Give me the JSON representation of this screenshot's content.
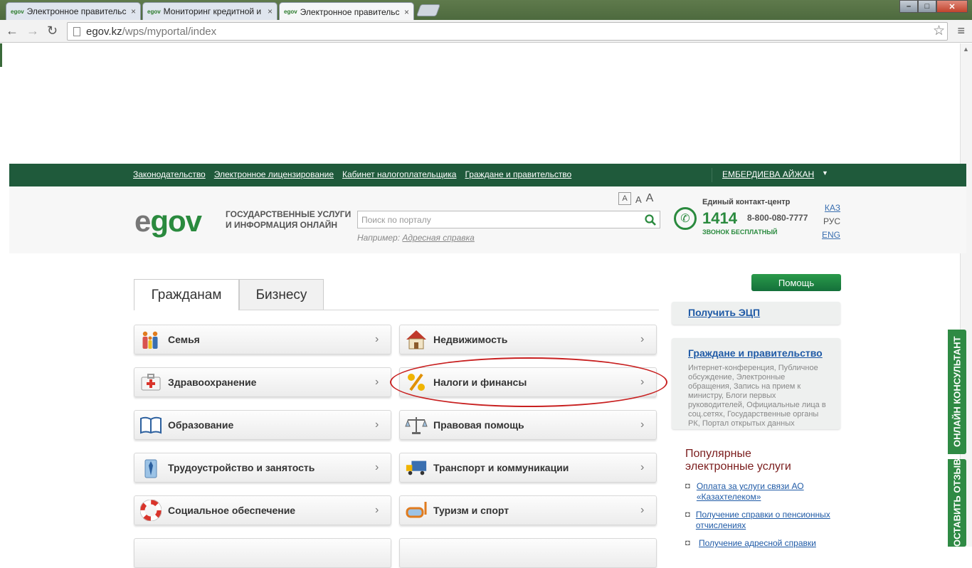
{
  "browser": {
    "tabs": [
      {
        "title": "Электронное правительс",
        "favicon": "egov"
      },
      {
        "title": "Мониторинг кредитной и",
        "favicon": "egov"
      },
      {
        "title": "Электронное правительс",
        "favicon": "egov"
      }
    ],
    "url_host": "egov.kz",
    "url_path": "/wps/myportal/index"
  },
  "topnav": {
    "links": [
      "Законодательство",
      "Электронное лицензирование",
      "Кабинет налогоплательщика",
      "Граждане и правительство"
    ],
    "user": "ЕМБЕРДИЕВА АЙЖАН"
  },
  "header": {
    "logo_e": "e",
    "logo_gov": "gov",
    "tagline1": "ГОСУДАРСТВЕННЫЕ УСЛУГИ",
    "tagline2": "И ИНФОРМАЦИЯ ОНЛАЙН",
    "font_sizes": [
      "A",
      "A",
      "A"
    ],
    "search_placeholder": "Поиск по порталу",
    "example_prefix": "Например:",
    "example_link": "Адресная справка",
    "contact_title": "Единый контакт-центр",
    "contact_number": "1414",
    "contact_alt": "8-800-080-7777",
    "contact_free": "ЗВОНОК БЕСПЛАТНЫЙ",
    "langs": [
      "КАЗ",
      "РУС",
      "ENG"
    ]
  },
  "content_tabs": [
    "Гражданам",
    "Бизнесу"
  ],
  "categories": [
    {
      "label": "Семья",
      "icon": "family-icon"
    },
    {
      "label": "Недвижимость",
      "icon": "house-icon"
    },
    {
      "label": "Здравоохранение",
      "icon": "medkit-icon"
    },
    {
      "label": "Налоги и финансы",
      "icon": "percent-icon"
    },
    {
      "label": "Образование",
      "icon": "book-icon"
    },
    {
      "label": "Правовая помощь",
      "icon": "scales-icon"
    },
    {
      "label": "Трудоустройство и занятость",
      "icon": "worker-icon"
    },
    {
      "label": "Транспорт и коммуникации",
      "icon": "truck-icon"
    },
    {
      "label": "Социальное обеспечение",
      "icon": "lifebuoy-icon"
    },
    {
      "label": "Туризм и спорт",
      "icon": "diving-mask-icon"
    }
  ],
  "sidebar": {
    "help": "Помощь",
    "ecp": "Получить ЭЦП",
    "gov_title": "Граждане и правительство",
    "gov_text": "Интернет-конференция, Публичное обсуждение, Электронные обращения, Запись на прием к министру, Блоги первых руководителей, Официальные лица в соц.сетях, Государственные органы РК, Портал открытых данных",
    "popular_title1": "Популярные",
    "popular_title2": "электронные услуги",
    "popular": [
      "Оплата за услуги связи АО «Казахтелеком»",
      "Получение справки о пенсионных отчислениях",
      "Получение адресной справки"
    ],
    "consultant": "ОНЛАЙН КОНСУЛЬТАНТ",
    "feedback": "ОСТАВИТЬ ОТЗЫВ"
  },
  "colors": {
    "brand_green": "#1f5a3b",
    "accent_green": "#2a8a3e",
    "highlight_red": "#c82020"
  }
}
